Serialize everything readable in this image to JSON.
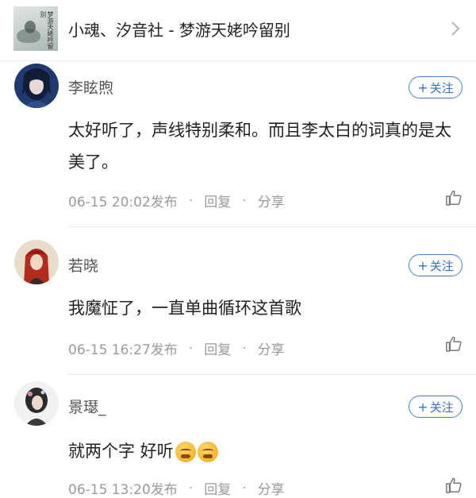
{
  "song": {
    "title": "小魂、汐音社 - 梦游天姥吟留别",
    "cover_text": "梦游天姥吟留别"
  },
  "follow_label": "关注",
  "comments": [
    {
      "username": "李眩煦",
      "text": "太好听了，声线特别柔和。而且李太白的词真的是太美了。",
      "time": "06-15 20:02发布",
      "reply": "回复",
      "share": "分享"
    },
    {
      "username": "若晓",
      "text": "我魔怔了，一直单曲循环这首歌",
      "time": "06-15 16:27发布",
      "reply": "回复",
      "share": "分享"
    },
    {
      "username": "景璱_",
      "text": "就两个字 好听",
      "emojis": [
        "grimace-emoji",
        "grimace-emoji"
      ],
      "time": "06-15 13:20发布",
      "reply": "回复",
      "share": "分享"
    }
  ],
  "colors": {
    "accent": "#3a6fbf",
    "meta_text": "#9a9a9a",
    "username": "#555555"
  }
}
